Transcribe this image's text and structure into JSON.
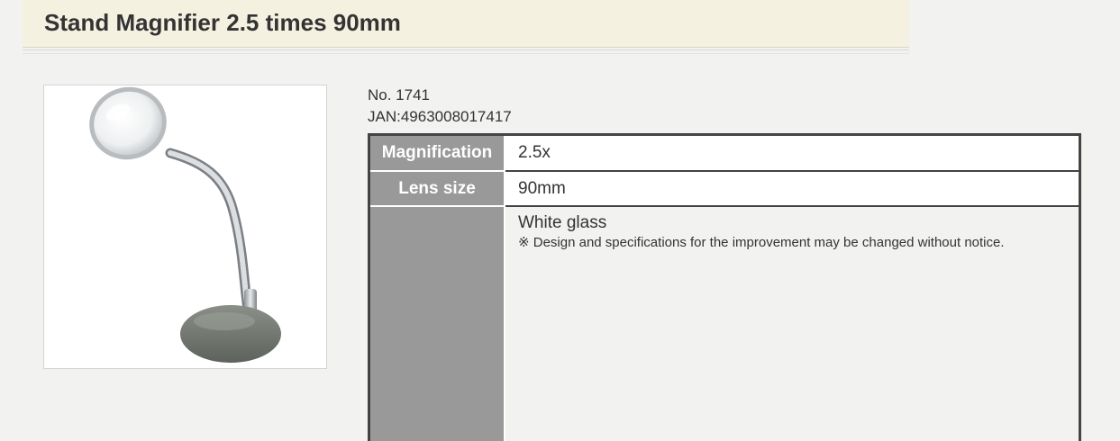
{
  "product": {
    "title": "Stand Magnifier 2.5 times 90mm",
    "image_alt": "Stand magnifier with round lens on flexible arm and grey base",
    "number": "No. 1741",
    "jan": "JAN:4963008017417"
  },
  "specs": [
    {
      "label": "Magnification",
      "value": "2.5x"
    },
    {
      "label": "Lens size",
      "value": "90mm"
    },
    {
      "label": "",
      "value": "White glass",
      "note": "※ Design and specifications for the improvement may be changed without notice."
    }
  ],
  "colors": {
    "title_bg": "#f5f1e1",
    "header_cell": "#999999",
    "border": "#444444",
    "page_bg": "#f2f2f0"
  }
}
